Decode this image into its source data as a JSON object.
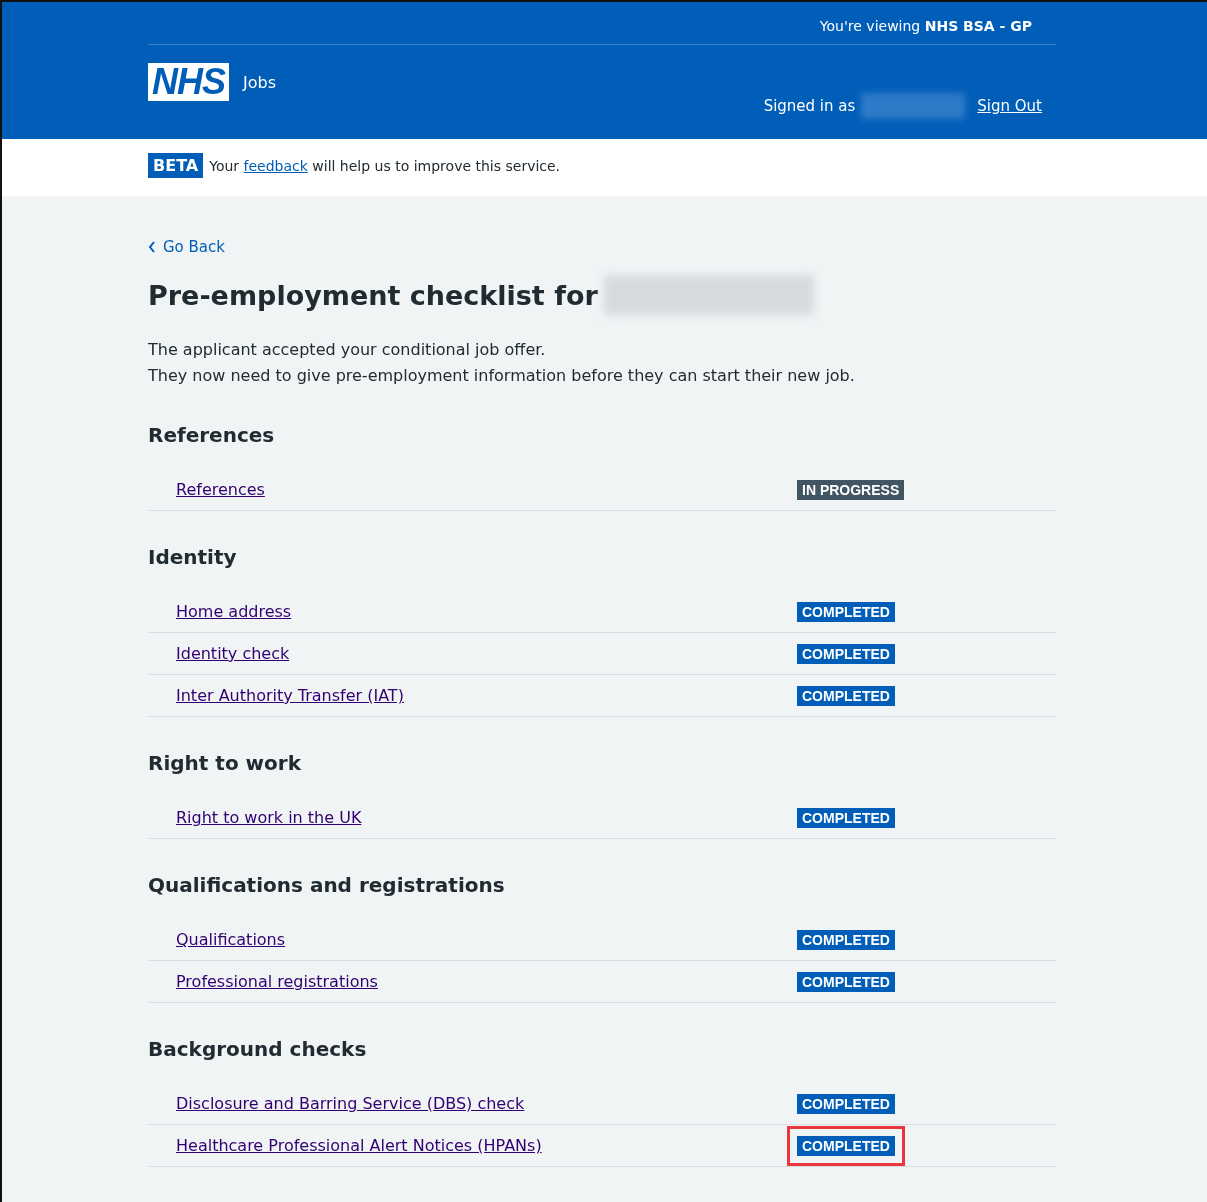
{
  "header": {
    "viewing_prefix": "You're viewing",
    "organisation": "NHS BSA - GP",
    "logo": "NHS",
    "service": "Jobs",
    "signed_in_label": "Signed in as",
    "sign_out": "Sign Out"
  },
  "beta_banner": {
    "tag": "BETA",
    "before": "Your",
    "link": "feedback",
    "after": "will help us to improve this service."
  },
  "back_link": "Go Back",
  "title": "Pre-employment checklist for",
  "intro": [
    "The applicant accepted your conditional job offer.",
    "They now need to give pre-employment information before they can start their new job."
  ],
  "sections": [
    {
      "heading": "References",
      "items": [
        {
          "label": "References",
          "status": "IN PROGRESS",
          "kind": "in_progress",
          "highlighted": false
        }
      ]
    },
    {
      "heading": "Identity",
      "items": [
        {
          "label": "Home address",
          "status": "COMPLETED",
          "kind": "completed",
          "highlighted": false
        },
        {
          "label": "Identity check",
          "status": "COMPLETED",
          "kind": "completed",
          "highlighted": false
        },
        {
          "label": "Inter Authority Transfer (IAT)",
          "status": "COMPLETED",
          "kind": "completed",
          "highlighted": false
        }
      ]
    },
    {
      "heading": "Right to work",
      "items": [
        {
          "label": "Right to work in the UK",
          "status": "COMPLETED",
          "kind": "completed",
          "highlighted": false
        }
      ]
    },
    {
      "heading": "Qualifications and registrations",
      "items": [
        {
          "label": "Qualifications",
          "status": "COMPLETED",
          "kind": "completed",
          "highlighted": false
        },
        {
          "label": "Professional registrations",
          "status": "COMPLETED",
          "kind": "completed",
          "highlighted": false
        }
      ]
    },
    {
      "heading": "Background checks",
      "items": [
        {
          "label": "Disclosure and Barring Service (DBS) check",
          "status": "COMPLETED",
          "kind": "completed",
          "highlighted": false
        },
        {
          "label": "Healthcare Professional Alert Notices (HPANs)",
          "status": "COMPLETED",
          "kind": "completed",
          "highlighted": true
        }
      ]
    }
  ]
}
